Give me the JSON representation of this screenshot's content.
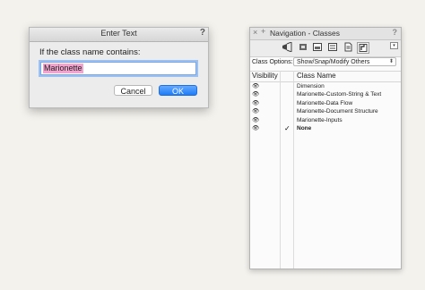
{
  "dialog": {
    "title": "Enter Text",
    "help": "?",
    "prompt": "If the class name contains:",
    "input_value": "Marionette",
    "cancel_label": "Cancel",
    "ok_label": "OK"
  },
  "palette": {
    "close_glyph": "×",
    "collapse_glyph": "+",
    "title": "Navigation - Classes",
    "help": "?",
    "toolbar_icons": [
      "megaphone-icon",
      "design-layer-icon",
      "sheet-layer-icon",
      "class-icon",
      "viewport-icon",
      "saved-view-icon"
    ],
    "class_options_label": "Class Options:",
    "class_options_value": "Show/Snap/Modify Others",
    "columns": {
      "visibility": "Visibility",
      "class_name": "Class Name"
    },
    "rows": [
      {
        "visible": true,
        "active": false,
        "name": "Dimension"
      },
      {
        "visible": true,
        "active": false,
        "name": "Marionette-Custom-String & Text"
      },
      {
        "visible": true,
        "active": false,
        "name": "Marionette-Data Flow"
      },
      {
        "visible": true,
        "active": false,
        "name": "Marionette-Document Structure"
      },
      {
        "visible": true,
        "active": false,
        "name": "Marionette-Inputs"
      },
      {
        "visible": true,
        "active": true,
        "name": "None"
      }
    ]
  }
}
